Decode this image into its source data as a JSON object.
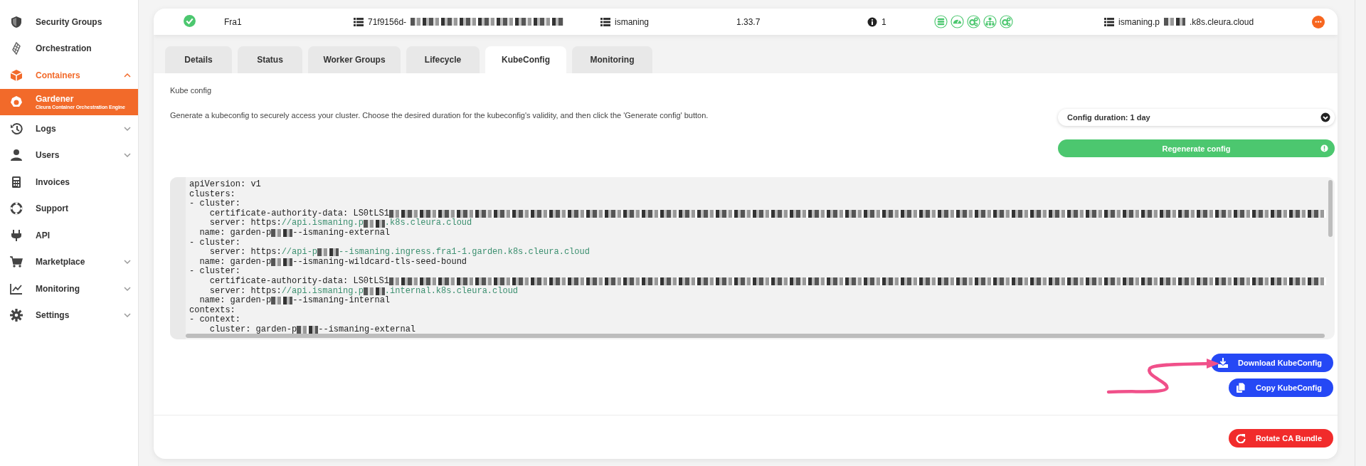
{
  "sidebar": {
    "items": [
      {
        "label": "Security Groups",
        "expandable": false,
        "expanded": false,
        "selected": false
      },
      {
        "label": "Orchestration",
        "expandable": false,
        "expanded": false,
        "selected": false
      },
      {
        "label": "Containers",
        "expandable": true,
        "expanded": true,
        "selected": false,
        "children": [
          {
            "label": "Gardener",
            "subtitle": "Cleura Container Orchestration Engine",
            "selected": true
          }
        ]
      },
      {
        "label": "Logs",
        "expandable": true,
        "expanded": false,
        "selected": false
      },
      {
        "label": "Users",
        "expandable": true,
        "expanded": false,
        "selected": false
      },
      {
        "label": "Invoices",
        "expandable": false,
        "expanded": false,
        "selected": false
      },
      {
        "label": "Support",
        "expandable": false,
        "expanded": false,
        "selected": false
      },
      {
        "label": "API",
        "expandable": false,
        "expanded": false,
        "selected": false
      },
      {
        "label": "Marketplace",
        "expandable": true,
        "expanded": false,
        "selected": false
      },
      {
        "label": "Monitoring",
        "expandable": true,
        "expanded": false,
        "selected": false
      },
      {
        "label": "Settings",
        "expandable": true,
        "expanded": false,
        "selected": false
      }
    ]
  },
  "cluster_row": {
    "status_ok": true,
    "region": "Fra1",
    "cluster_id": [
      {
        "kind": "plain",
        "text": "71f9156d-"
      },
      {
        "kind": "redacted_long"
      }
    ],
    "name": "ismaning",
    "version": "1.33.7",
    "info_count": "1",
    "hostname": [
      {
        "kind": "plain",
        "text": "ismaning.p"
      },
      {
        "kind": "redacted"
      },
      {
        "kind": "plain",
        "text": ".k8s.cleura.cloud"
      }
    ]
  },
  "tabs": [
    {
      "label": "Details",
      "selected": false
    },
    {
      "label": "Status",
      "selected": false
    },
    {
      "label": "Worker Groups",
      "selected": false
    },
    {
      "label": "Lifecycle",
      "selected": false
    },
    {
      "label": "KubeConfig",
      "selected": true
    },
    {
      "label": "Monitoring",
      "selected": false
    }
  ],
  "kubeconfig": {
    "heading": "Kube config",
    "description": "Generate a kubeconfig to securely access your cluster. Choose the desired duration for the kubeconfig's validity, and then click the 'Generate config' button.",
    "duration_select": {
      "value": "Config duration: 1 day"
    },
    "regenerate_button": "Regenerate config",
    "code_lines": [
      [
        {
          "kind": "plain",
          "text": "apiVersion: v1"
        }
      ],
      [
        {
          "kind": "plain",
          "text": "clusters:"
        }
      ],
      [
        {
          "kind": "plain",
          "text": "- cluster:"
        }
      ],
      [
        {
          "kind": "plain",
          "text": "    certificate-authority-data: LS0tLS1"
        },
        {
          "kind": "redacted_long"
        }
      ],
      [
        {
          "kind": "plain",
          "text": "    server: https:"
        },
        {
          "kind": "link",
          "text": "//api.ismaning.p"
        },
        {
          "kind": "redacted"
        },
        {
          "kind": "link",
          "text": ".k8s.cleura.cloud"
        }
      ],
      [
        {
          "kind": "plain",
          "text": "  name: garden-p"
        },
        {
          "kind": "redacted"
        },
        {
          "kind": "plain",
          "text": "--ismaning-external"
        }
      ],
      [
        {
          "kind": "plain",
          "text": "- cluster:"
        }
      ],
      [
        {
          "kind": "plain",
          "text": "    server: https:"
        },
        {
          "kind": "link",
          "text": "//api-p"
        },
        {
          "kind": "redacted"
        },
        {
          "kind": "link",
          "text": "--ismaning.ingress.fra1-1.garden.k8s.cleura.cloud"
        }
      ],
      [
        {
          "kind": "plain",
          "text": "  name: garden-p"
        },
        {
          "kind": "redacted"
        },
        {
          "kind": "plain",
          "text": "--ismaning-wildcard-tls-seed-bound"
        }
      ],
      [
        {
          "kind": "plain",
          "text": "- cluster:"
        }
      ],
      [
        {
          "kind": "plain",
          "text": "    certificate-authority-data: LS0tLS1"
        },
        {
          "kind": "redacted_long"
        }
      ],
      [
        {
          "kind": "plain",
          "text": "    server: https:"
        },
        {
          "kind": "link",
          "text": "//api.ismaning.p"
        },
        {
          "kind": "redacted"
        },
        {
          "kind": "link",
          "text": ".internal.k8s.cleura.cloud"
        }
      ],
      [
        {
          "kind": "plain",
          "text": "  name: garden-p"
        },
        {
          "kind": "redacted"
        },
        {
          "kind": "plain",
          "text": "--ismaning-internal"
        }
      ],
      [
        {
          "kind": "plain",
          "text": "contexts:"
        }
      ],
      [
        {
          "kind": "plain",
          "text": "- context:"
        }
      ],
      [
        {
          "kind": "plain",
          "text": "    cluster: garden-p"
        },
        {
          "kind": "redacted"
        },
        {
          "kind": "plain",
          "text": "--ismaning-external"
        }
      ]
    ],
    "download_button": "Download KubeConfig",
    "copy_button": "Copy KubeConfig",
    "rotate_button": "Rotate CA Bundle"
  }
}
